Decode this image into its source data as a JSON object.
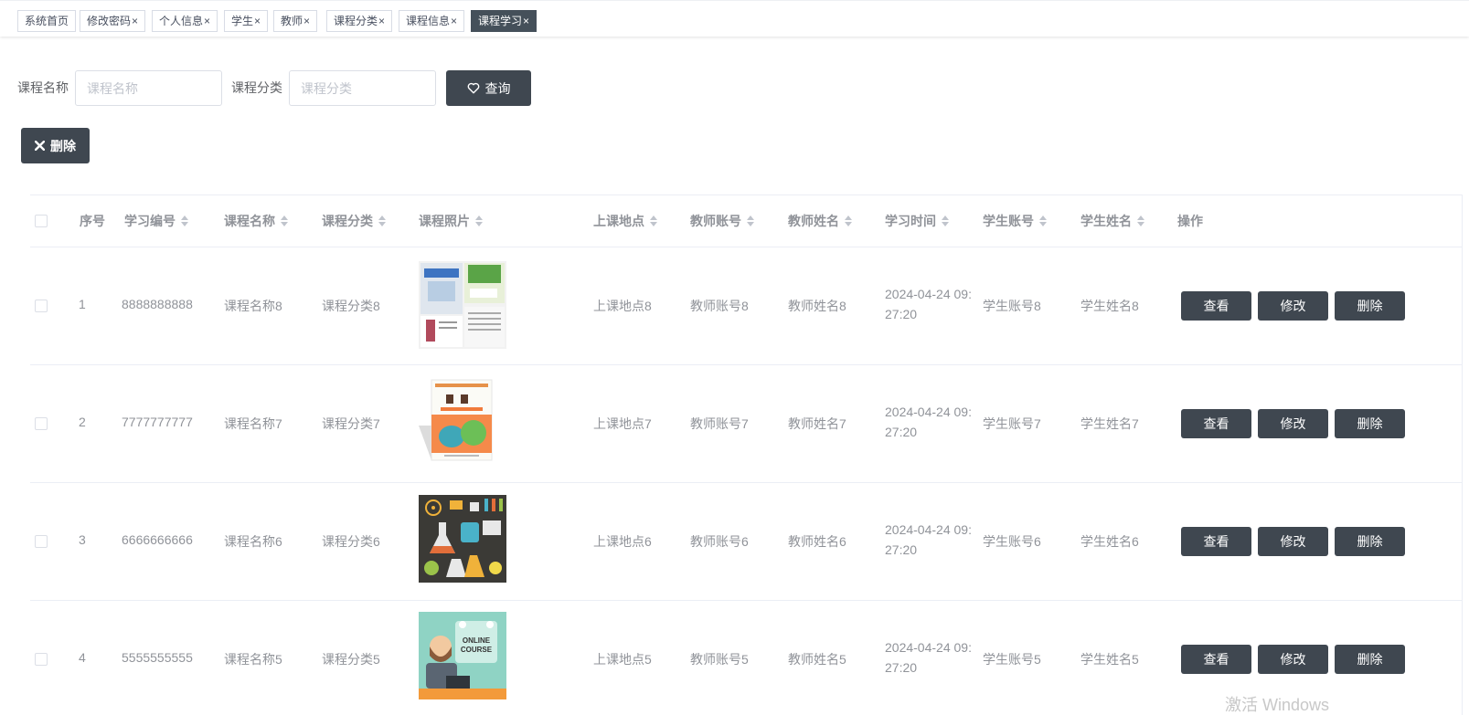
{
  "tabs": [
    {
      "label": "系统首页",
      "close": ""
    },
    {
      "label": "修改密码",
      "close": "×"
    },
    {
      "label": "个人信息",
      "close": "×"
    },
    {
      "label": "学生",
      "close": "×"
    },
    {
      "label": "教师",
      "close": "×"
    },
    {
      "label": "课程分类",
      "close": "×"
    },
    {
      "label": "课程信息",
      "close": "×"
    },
    {
      "label": "课程学习",
      "close": "×"
    }
  ],
  "search": {
    "course_name_label": "课程名称",
    "course_name_placeholder": "课程名称",
    "course_category_label": "课程分类",
    "course_category_placeholder": "课程分类",
    "query_label": "查询"
  },
  "toolbar": {
    "delete_label": "删除"
  },
  "table": {
    "headers": [
      "序号",
      "学习编号",
      "课程名称",
      "课程分类",
      "课程照片",
      "上课地点",
      "教师账号",
      "教师姓名",
      "学习时间",
      "学生账号",
      "学生姓名",
      "操作"
    ],
    "rows": [
      {
        "index": "1",
        "study_no": "8888888888",
        "course_name": "课程名称8",
        "category": "课程分类8",
        "photo_icon": "textbook-cover-icon",
        "location": "上课地点8",
        "teacher_account": "教师账号8",
        "teacher_name": "教师姓名8",
        "study_time": "2024-04-24 09:27:20",
        "student_account": "学生账号8",
        "student_name": "学生姓名8"
      },
      {
        "index": "2",
        "study_no": "7777777777",
        "course_name": "课程名称7",
        "category": "课程分类7",
        "photo_icon": "chinese-book-icon",
        "location": "上课地点7",
        "teacher_account": "教师账号7",
        "teacher_name": "教师姓名7",
        "study_time": "2024-04-24 09:27:20",
        "student_account": "学生账号7",
        "student_name": "学生姓名7"
      },
      {
        "index": "3",
        "study_no": "6666666666",
        "course_name": "课程名称6",
        "category": "课程分类6",
        "photo_icon": "science-lab-icon",
        "location": "上课地点6",
        "teacher_account": "教师账号6",
        "teacher_name": "教师姓名6",
        "study_time": "2024-04-24 09:27:20",
        "student_account": "学生账号6",
        "student_name": "学生姓名6"
      },
      {
        "index": "4",
        "study_no": "5555555555",
        "course_name": "课程名称5",
        "category": "课程分类5",
        "photo_icon": "online-course-icon",
        "photo_text_1": "ONLINE",
        "photo_text_2": "COURSE",
        "location": "上课地点5",
        "teacher_account": "教师账号5",
        "teacher_name": "教师姓名5",
        "study_time": "2024-04-24 09:27:20",
        "student_account": "学生账号5",
        "student_name": "学生姓名5"
      }
    ],
    "actions": {
      "view": "查看",
      "edit": "修改",
      "delete": "删除"
    }
  },
  "watermark": "激活 Windows",
  "colors": {
    "dark_button": "#3f4750",
    "active_tab": "#45505a",
    "border": "#ebeef5"
  }
}
